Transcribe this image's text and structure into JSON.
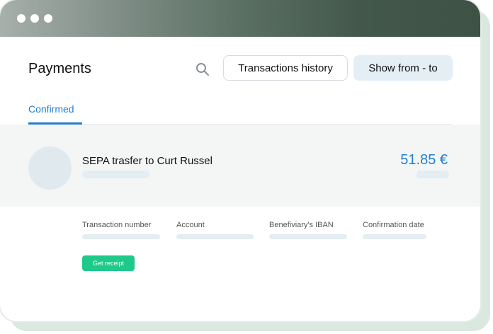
{
  "page": {
    "title": "Payments",
    "search_icon": "search-icon",
    "buttons": {
      "transactions_history": "Transactions history",
      "show_from_to": "Show from - to"
    },
    "tabs": [
      {
        "label": "Confirmed",
        "active": true
      }
    ]
  },
  "transaction": {
    "title": "SEPA trasfer to Curt Russel",
    "amount": "51.85 €",
    "details": {
      "transaction_number": "Transaction number",
      "account": "Account",
      "beneficiary_iban": "Benefiviary's IBAN",
      "confirmation_date": "Confirmation date"
    },
    "receipt_button": "Get receipt"
  },
  "colors": {
    "accent": "#1f7fd0",
    "success": "#1ec98a",
    "titlebar_dark": "#3e5245"
  }
}
